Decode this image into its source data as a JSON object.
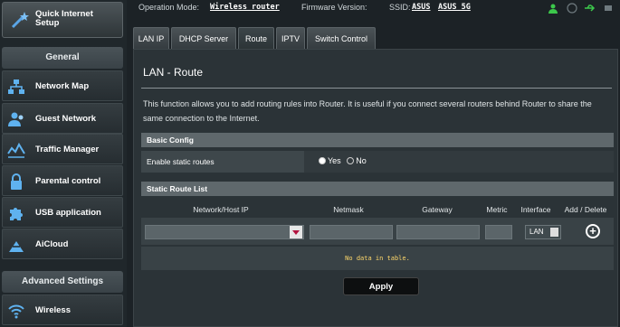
{
  "sidebar": {
    "quick_setup": "Quick Internet Setup",
    "general_title": "General",
    "general_items": [
      {
        "label": "Network Map",
        "icon": "network-map-icon"
      },
      {
        "label": "Guest Network",
        "icon": "guest-network-icon"
      },
      {
        "label": "Traffic Manager",
        "icon": "traffic-manager-icon"
      },
      {
        "label": "Parental control",
        "icon": "parental-control-icon"
      },
      {
        "label": "USB application",
        "icon": "usb-application-icon"
      },
      {
        "label": "AiCloud",
        "icon": "aicloud-icon"
      }
    ],
    "advanced_title": "Advanced Settings",
    "advanced_items": [
      {
        "label": "Wireless",
        "icon": "wireless-icon"
      }
    ]
  },
  "status": {
    "mode_label": "Operation Mode:",
    "mode_value": "Wireless router",
    "firmware_label": "Firmware Version:",
    "ssid_label": "SSID:",
    "ssid_1": "ASUS",
    "ssid_2": "ASUS_5G"
  },
  "tabs": [
    "LAN IP",
    "DHCP Server",
    "Route",
    "IPTV",
    "Switch Control"
  ],
  "active_tab": "Route",
  "page": {
    "title": "LAN - Route",
    "description": "This function allows you to add routing rules into Router. It is useful if you connect several routers behind Router to share the same connection to the Internet."
  },
  "basic_config": {
    "header": "Basic Config",
    "enable_label": "Enable static routes",
    "yes": "Yes",
    "no": "No",
    "selected": "Yes"
  },
  "route_list": {
    "header": "Static Route List",
    "columns": [
      "Network/Host IP",
      "Netmask",
      "Gateway",
      "Metric",
      "Interface",
      "Add / Delete"
    ],
    "interface_value": "LAN",
    "no_data": "No data in table."
  },
  "apply_label": "Apply",
  "colors": {
    "accent": "#b3133f",
    "nodata": "#ffd86b",
    "status_icon_green": "#3cc84b"
  }
}
